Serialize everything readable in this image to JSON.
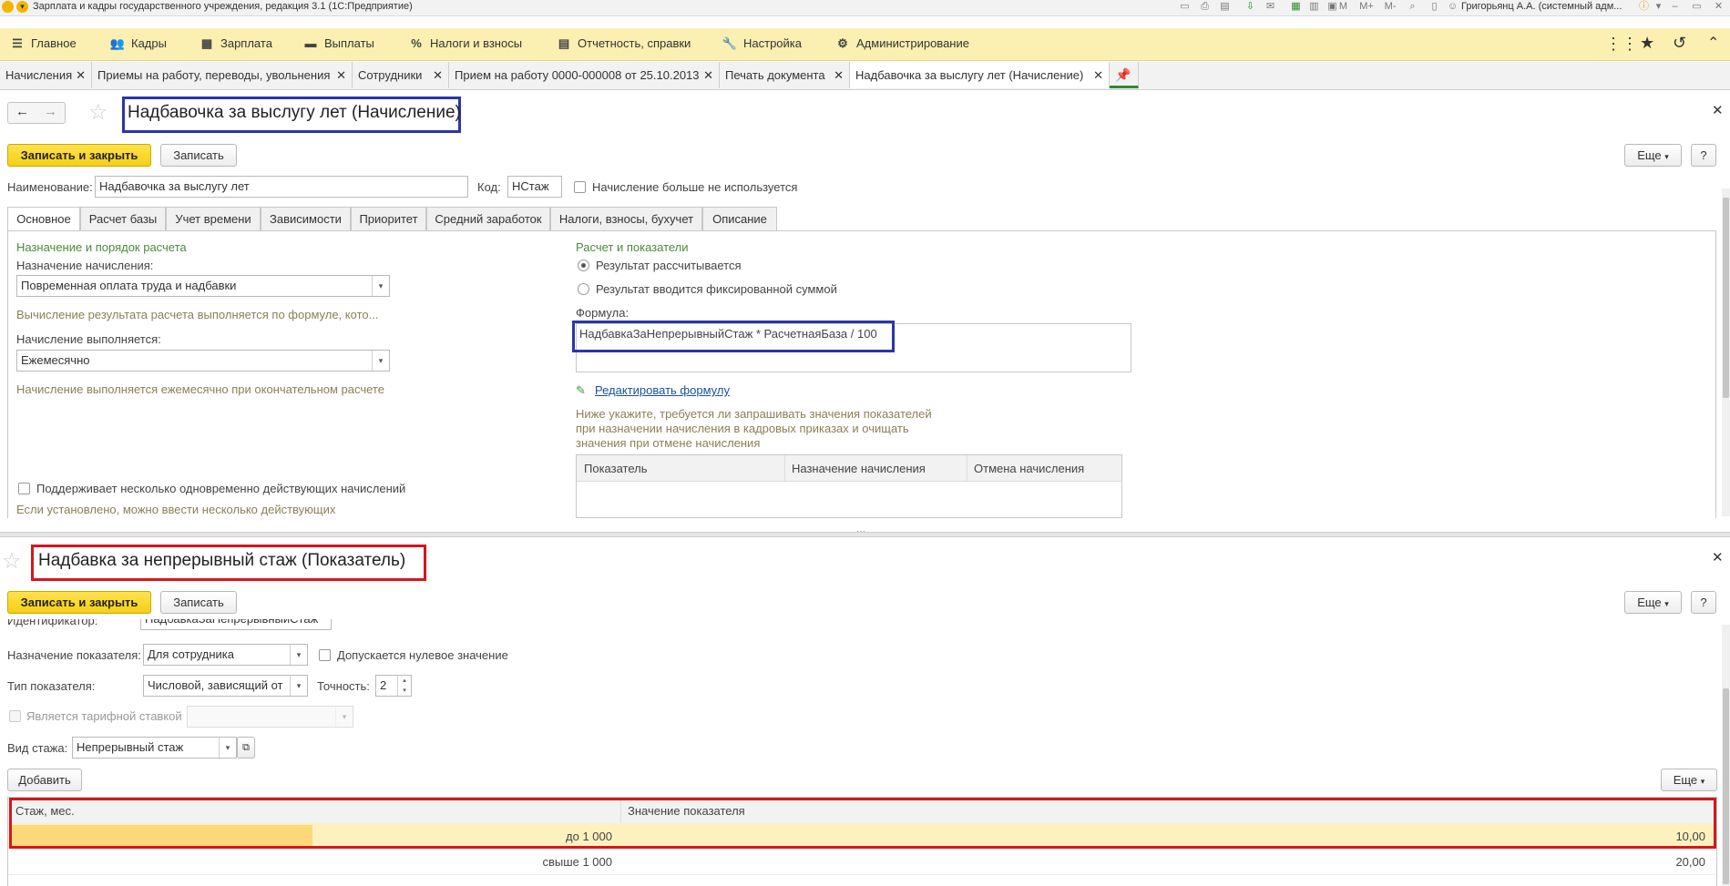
{
  "window": {
    "title": "Зарплата и кадры государственного учреждения, редакция 3.1  (1С:Предприятие)",
    "user": "Григорьянц А.А. (системный адм..."
  },
  "menu": [
    {
      "label": "Главное",
      "icon": "menu-icon"
    },
    {
      "label": "Кадры",
      "icon": "people-icon"
    },
    {
      "label": "Зарплата",
      "icon": "calculator-icon"
    },
    {
      "label": "Выплаты",
      "icon": "wallet-icon"
    },
    {
      "label": "Налоги и взносы",
      "icon": "percent-icon"
    },
    {
      "label": "Отчетность, справки",
      "icon": "report-icon"
    },
    {
      "label": "Настройка",
      "icon": "wrench-icon"
    },
    {
      "label": "Администрирование",
      "icon": "gear-icon"
    }
  ],
  "open_tabs": [
    "Начисления",
    "Приемы на работу, переводы, увольнения",
    "Сотрудники",
    "Прием на работу 0000-000008 от 25.10.2013",
    "Печать документа",
    "Надбавочка за выслугу лет (Начисление)"
  ],
  "form1": {
    "title": "Надбавочка за выслугу лет (Начисление)",
    "btn_save_close": "Записать и закрыть",
    "btn_save": "Записать",
    "btn_more": "Еще",
    "btn_help": "?",
    "name_label": "Наименование:",
    "name_value": "Надбавочка за выслугу лет",
    "code_label": "Код:",
    "code_value": "НСтаж",
    "unused_label": "Начисление больше не используется",
    "tabs": [
      "Основное",
      "Расчет базы",
      "Учет времени",
      "Зависимости",
      "Приоритет",
      "Средний заработок",
      "Налоги, взносы, бухучет",
      "Описание"
    ],
    "left": {
      "section": "Назначение и порядок расчета",
      "purpose_label": "Назначение начисления:",
      "purpose_value": "Повременная оплата труда и надбавки",
      "purpose_hint": "Вычисление результата расчета выполняется по формуле, кото...",
      "period_label": "Начисление выполняется:",
      "period_value": "Ежемесячно",
      "period_hint": "Начисление выполняется ежемесячно при окончательном расчете",
      "multi_label": "Поддерживает несколько одновременно действующих начислений",
      "multi_hint": "Если установлено, можно ввести несколько действующих"
    },
    "right": {
      "section": "Расчет и показатели",
      "radio1": "Результат рассчитывается",
      "radio2": "Результат вводится фиксированной суммой",
      "formula_label": "Формула:",
      "formula_value": "НадбавкаЗаНепрерывныйСтаж * РасчетнаяБаза / 100",
      "edit_link": "Редактировать формулу",
      "note1": "Ниже укажите, требуется ли запрашивать значения показателей",
      "note2": "при назначении начисления в кадровых приказах и очищать",
      "note3": "значения при отмене начисления",
      "table_cols": [
        "Показатель",
        "Назначение начисления",
        "Отмена начисления"
      ]
    }
  },
  "form2": {
    "title": "Надбавка за непрерывный стаж (Показатель)",
    "btn_save_close": "Записать и закрыть",
    "btn_save": "Записать",
    "btn_more": "Еще",
    "btn_help": "?",
    "id_label": "Идентификатор:",
    "id_value": "НадбавкаЗаНепрерывныйСтаж",
    "purpose_label": "Назначение показателя:",
    "purpose_value": "Для сотрудника",
    "zero_label": "Допускается нулевое значение",
    "type_label": "Тип показателя:",
    "type_value": "Числовой, зависящий от",
    "precision_label": "Точность:",
    "precision_value": "2",
    "tariff_label": "Является тарифной ставкой",
    "stazh_label": "Вид стажа:",
    "stazh_value": "Непрерывный стаж",
    "btn_add": "Добавить",
    "btn_more2": "Еще",
    "table_cols": [
      "Стаж, мес.",
      "Значение показателя"
    ],
    "rows": [
      {
        "stazh": "до 1 000",
        "value": "10,00"
      },
      {
        "stazh": "свыше 1 000",
        "value": "20,00"
      }
    ]
  },
  "colors": {
    "menu_bg": "#fbefb1",
    "primary_btn": "#f6cf15",
    "highlight_blue": "#2b35a8",
    "highlight_red": "#d6161e",
    "selected_row": "#fdf1c0",
    "section_green": "#4a8a3c"
  }
}
